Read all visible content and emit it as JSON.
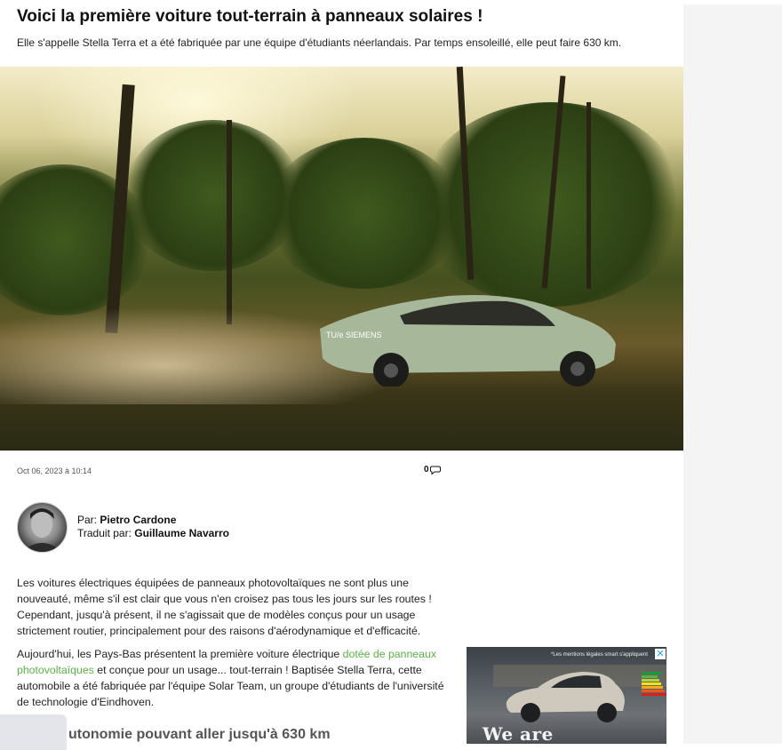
{
  "article": {
    "title": "Voici la première voiture tout-terrain à panneaux solaires !",
    "subtitle": "Elle s'appelle Stella Terra et a été fabriquée par une équipe d'étudiants néerlandais. Par temps ensoleillé, elle peut faire 630 km.",
    "hero_image_alt": "Stella Terra solar off-road car driving on a dirt trail through a forest",
    "car_branding": "TU/e SIEMENS",
    "date": "Oct 06, 2023 à 10:14",
    "comment_count": "0",
    "comment_icon": "speech-bubble-icon",
    "author_label": "Par:",
    "author_name": "Pietro Cardone",
    "translator_label": "Traduit par:",
    "translator_name": "Guillaume Navarro",
    "paragraph1": "Les voitures électriques équipées de panneaux photovoltaïques ne sont plus une nouveauté, même s'il est clair que vous n'en croisez pas tous les jours sur les routes ! Cependant, jusqu'à présent, il ne s'agissait que de modèles conçus pour un usage strictement routier, principalement pour des raisons d'aérodynamique et d'efficacité.",
    "paragraph2_before": "Aujourd'hui, les Pays-Bas présentent la première voiture électrique ",
    "paragraph2_link": "dotée de panneaux photovoltaïques",
    "paragraph2_after": " et conçue pour un usage... tout-terrain ! Baptisée Stella Terra, cette automobile a été fabriquée par l'équipe Solar Team, un groupe d'étudiants de l'université de technologie d'Eindhoven.",
    "heading2_visible": "utonomie pouvant aller jusqu'à 630 km"
  },
  "ad": {
    "legal": "*Les mentions légales smart s'appliquent",
    "slogan": "We are tomorrow.*",
    "close_icon": "close-icon"
  },
  "colors": {
    "link": "#5cb046",
    "sidebar_bg": "#f4f4f4",
    "ad_close": "#29a3d9"
  }
}
